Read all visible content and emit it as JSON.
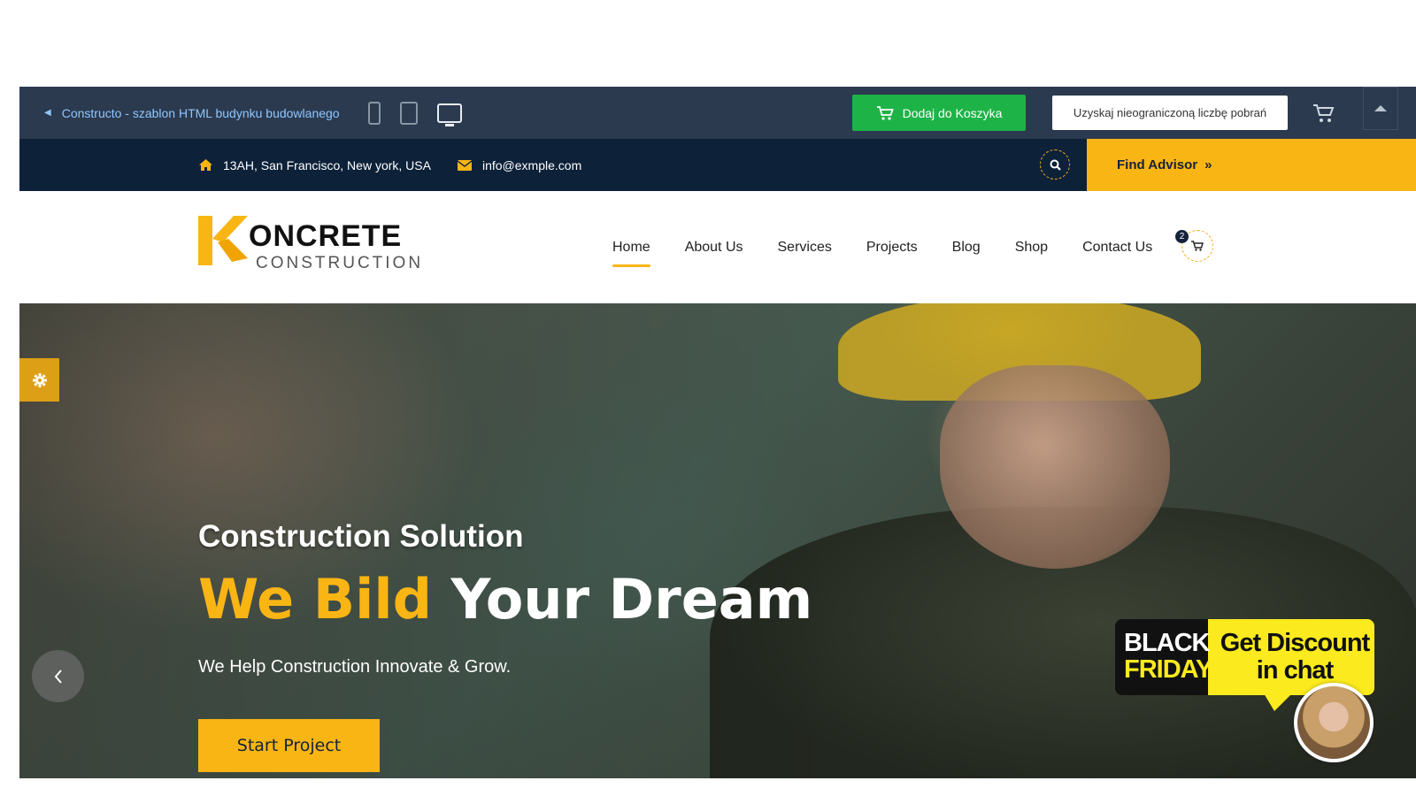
{
  "toolbar": {
    "back_label": "Constructo - szablon HTML budynku budowlanego",
    "devices": [
      "phone-icon",
      "tablet-icon",
      "desktop-icon"
    ],
    "add_to_cart": "Dodaj do Koszyka",
    "unlimited_downloads": "Uzyskaj nieograniczoną liczbę pobrań"
  },
  "infobar": {
    "address": "13AH, San Francisco, New york, USA",
    "email": "info@exmple.com",
    "find_advisor": "Find Advisor",
    "find_advisor_icon": "»"
  },
  "logo": {
    "letter": "K",
    "word": "ONCRETE",
    "sub": "CONSTRUCTION"
  },
  "nav": {
    "items": [
      "Home",
      "About Us",
      "Services",
      "Projects",
      "Blog",
      "Shop",
      "Contact Us"
    ],
    "active": "Home",
    "cart_count": "2"
  },
  "hero": {
    "subtitle": "Construction Solution",
    "title_highlight": "We Bild",
    "title_rest": " Your Dream",
    "text": "We Help Construction Innovate & Grow.",
    "button": "Start Project"
  },
  "promo": {
    "line1": "BLACK",
    "line2": "FRIDAY",
    "discount": "Get Discount in chat"
  },
  "colors": {
    "toolbar_bg": "#2b3a4f",
    "infobar_bg": "#0d2139",
    "accent": "#f9b514",
    "green": "#1eb347"
  }
}
